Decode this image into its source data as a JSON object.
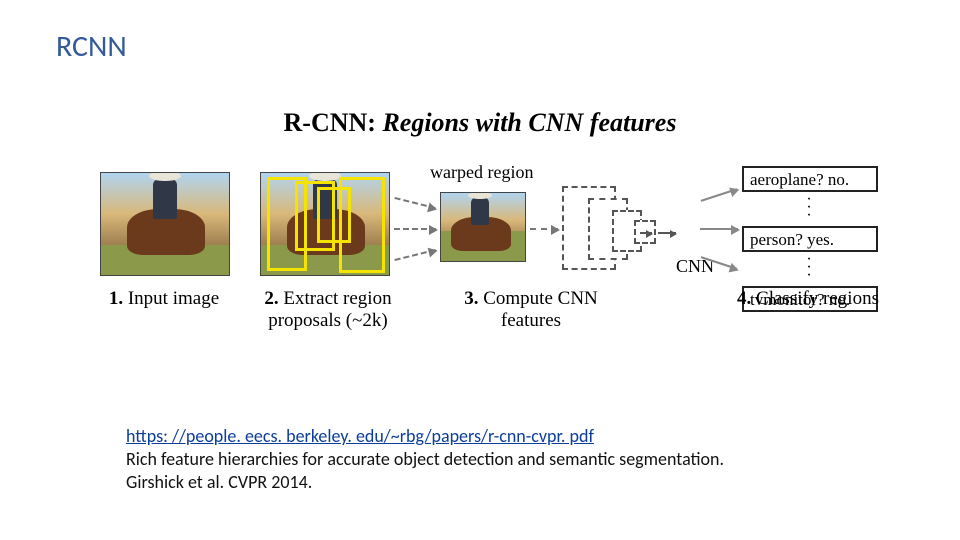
{
  "slide": {
    "title": "RCNN"
  },
  "figure": {
    "title_bold": "R-CNN:",
    "title_ital": "Regions with CNN features",
    "warped_label": "warped region",
    "cnn_label": "CNN",
    "steps": [
      {
        "num": "1.",
        "text": "Input image"
      },
      {
        "num": "2.",
        "text": "Extract region proposals (~2k)"
      },
      {
        "num": "3.",
        "text": "Compute CNN features"
      },
      {
        "num": "4.",
        "text": "Classify regions"
      }
    ],
    "classes": [
      "aeroplane? no.",
      "person? yes.",
      "tvmonitor? no."
    ]
  },
  "footer": {
    "link": "https: //people. eecs. berkeley. edu/~rbg/papers/r-cnn-cvpr. pdf",
    "line1": "Rich feature hierarchies for accurate object detection and semantic segmentation.",
    "line2": "Girshick et al. CVPR 2014."
  }
}
